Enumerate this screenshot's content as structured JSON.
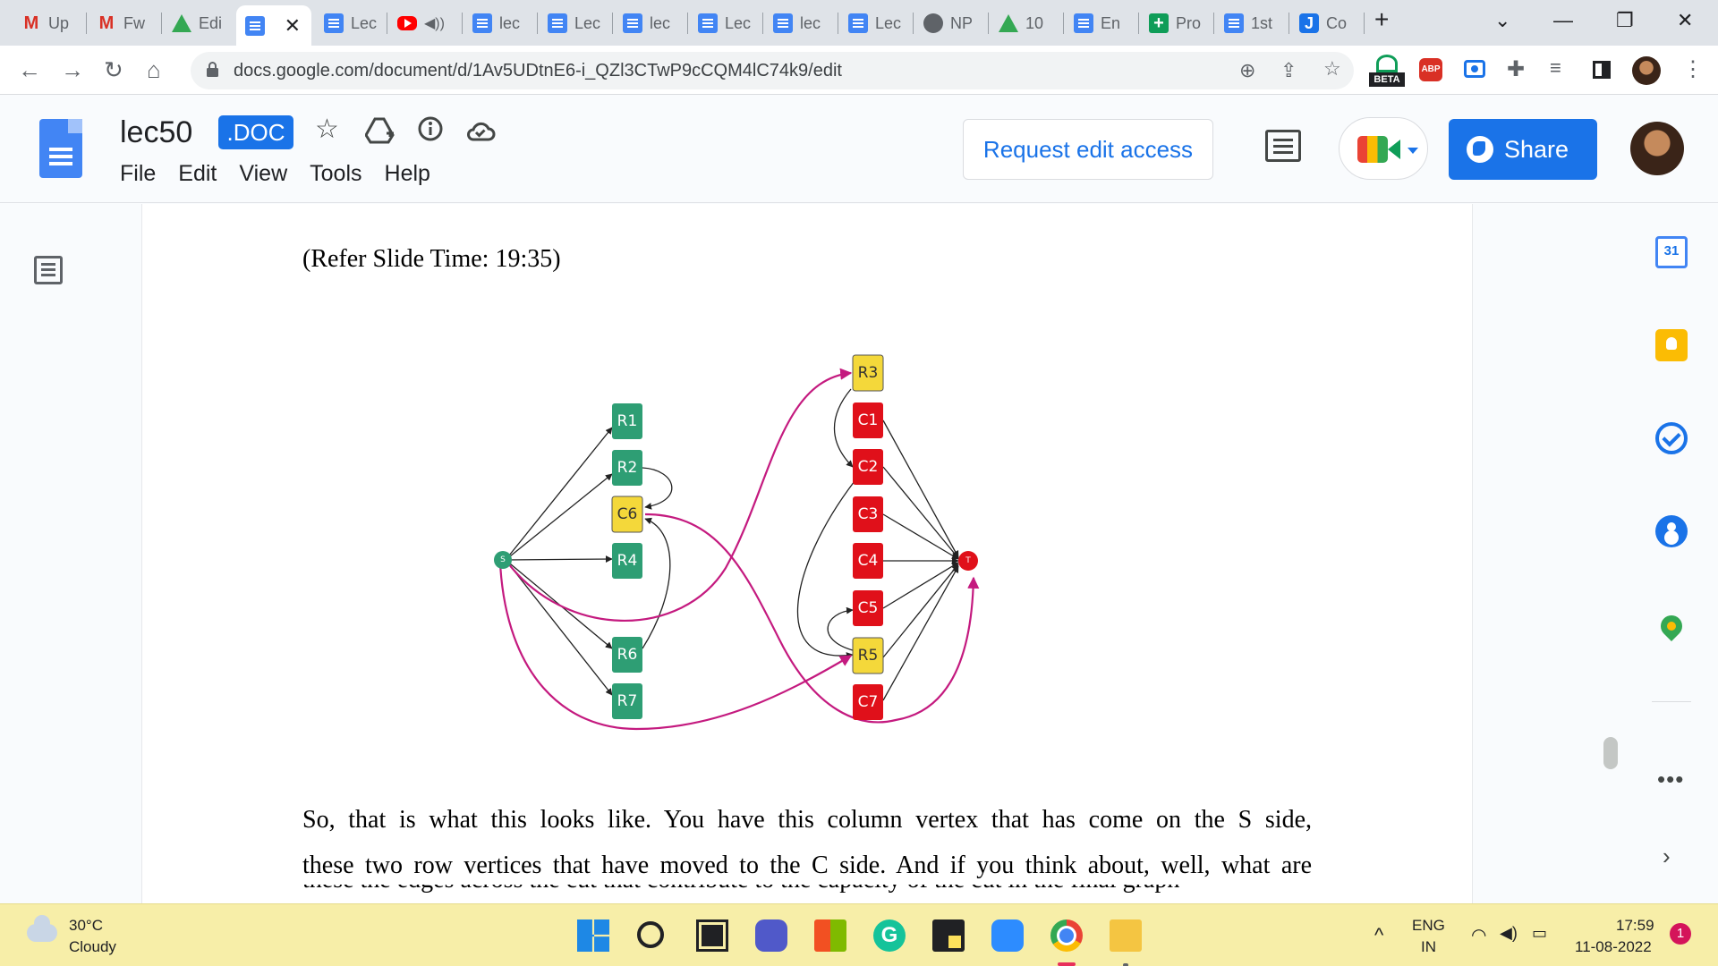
{
  "browser": {
    "tabs": [
      {
        "label": "Up",
        "icon": "gmail-icon"
      },
      {
        "label": "Fw",
        "icon": "gmail-icon"
      },
      {
        "label": "Edi",
        "icon": "drive-icon"
      },
      {
        "label": "",
        "icon": "docs-icon",
        "active": true
      },
      {
        "label": "Lec",
        "icon": "docs-icon"
      },
      {
        "label": "",
        "icon": "youtube-icon",
        "audio": true
      },
      {
        "label": "lec",
        "icon": "docs-icon"
      },
      {
        "label": "Lec",
        "icon": "docs-icon"
      },
      {
        "label": "lec",
        "icon": "docs-icon"
      },
      {
        "label": "Lec",
        "icon": "docs-icon"
      },
      {
        "label": "lec",
        "icon": "docs-icon"
      },
      {
        "label": "Lec",
        "icon": "docs-icon"
      },
      {
        "label": "NP",
        "icon": "globe-icon"
      },
      {
        "label": "10",
        "icon": "drive-icon"
      },
      {
        "label": "En",
        "icon": "docs-icon"
      },
      {
        "label": "Pro",
        "icon": "sheets-icon"
      },
      {
        "label": "1st",
        "icon": "docs-icon"
      },
      {
        "label": "Co",
        "icon": "j-icon"
      }
    ],
    "new_tab_symbol": "+",
    "url": "docs.google.com/document/d/1Av5UDtnE6-i_QZl3CTwP9cCQM4lC74k9/edit",
    "extensions": {
      "beta_label": "BETA",
      "abp_label": "ABP"
    }
  },
  "docs": {
    "title": "lec50",
    "badge": ".DOC",
    "menu": [
      "File",
      "Edit",
      "View",
      "Tools",
      "Help"
    ],
    "request_edit": "Request edit access",
    "share": "Share"
  },
  "document": {
    "slide_ref": "(Refer Slide Time: 19:35)",
    "paragraph_lines": [
      "So, that is what this looks like. You have this column vertex that has come on the S side,",
      "these two row vertices that have moved to the C side. And if you think about, well, what are"
    ],
    "partial_line": "these the edges across the cut that contribute to the capacity of the cut in the final graph",
    "figure": {
      "nodes": [
        {
          "id": "S",
          "label": "S",
          "color": "#2e9e74"
        },
        {
          "id": "R1",
          "label": "R1",
          "color": "#2e9e74"
        },
        {
          "id": "R2",
          "label": "R2",
          "color": "#2e9e74"
        },
        {
          "id": "C6",
          "label": "C6",
          "color": "#f4d83a"
        },
        {
          "id": "R4",
          "label": "R4",
          "color": "#2e9e74"
        },
        {
          "id": "R6",
          "label": "R6",
          "color": "#2e9e74"
        },
        {
          "id": "R7",
          "label": "R7",
          "color": "#2e9e74"
        },
        {
          "id": "R3",
          "label": "R3",
          "color": "#f4d83a"
        },
        {
          "id": "C1",
          "label": "C1",
          "color": "#e0101a"
        },
        {
          "id": "C2",
          "label": "C2",
          "color": "#e0101a"
        },
        {
          "id": "C3",
          "label": "C3",
          "color": "#e0101a"
        },
        {
          "id": "C4",
          "label": "C4",
          "color": "#e0101a"
        },
        {
          "id": "C5",
          "label": "C5",
          "color": "#e0101a"
        },
        {
          "id": "R5",
          "label": "R5",
          "color": "#f4d83a"
        },
        {
          "id": "C7",
          "label": "C7",
          "color": "#e0101a"
        },
        {
          "id": "T",
          "label": "T",
          "color": "#e0101a"
        }
      ],
      "cut_edge_color": "#c41a7f"
    }
  },
  "side_panel": {
    "calendar_day": "31",
    "more": "•••",
    "expand": "›"
  },
  "taskbar": {
    "temperature": "30°C",
    "weather": "Cloudy",
    "lang_top": "ENG",
    "lang_bottom": "IN",
    "time": "17:59",
    "date": "11-08-2022",
    "notifications": "1"
  }
}
